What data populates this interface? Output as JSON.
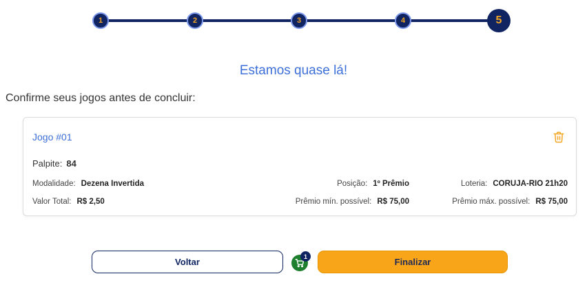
{
  "stepper": {
    "steps": [
      {
        "label": "1"
      },
      {
        "label": "2"
      },
      {
        "label": "3"
      },
      {
        "label": "4"
      },
      {
        "label": "5"
      }
    ],
    "active_step": 5
  },
  "heading": "Estamos quase lá!",
  "subheading": "Confirme seus jogos antes de concluir:",
  "game": {
    "title": "Jogo #01",
    "palpite_label": "Palpite:",
    "palpite_value": "84",
    "modalidade_label": "Modalidade:",
    "modalidade_value": "Dezena Invertida",
    "posicao_label": "Posição:",
    "posicao_value": "1º Prêmio",
    "loteria_label": "Loteria:",
    "loteria_value": "CORUJA-RIO 21h20",
    "valor_total_label": "Valor Total:",
    "valor_total_value": "R$ 2,50",
    "premio_min_label": "Prêmio mín. possível:",
    "premio_min_value": "R$ 75,00",
    "premio_max_label": "Prêmio máx. possível:",
    "premio_max_value": "R$ 75,00"
  },
  "actions": {
    "back_label": "Voltar",
    "finish_label": "Finalizar",
    "cart_count": "1"
  },
  "colors": {
    "navy": "#0f2461",
    "accent_blue": "#3c6fd8",
    "orange": "#f9a51a",
    "cart_green": "#1e7f2e"
  },
  "icons": {
    "delete": "trash-icon",
    "cart": "cart-icon"
  }
}
